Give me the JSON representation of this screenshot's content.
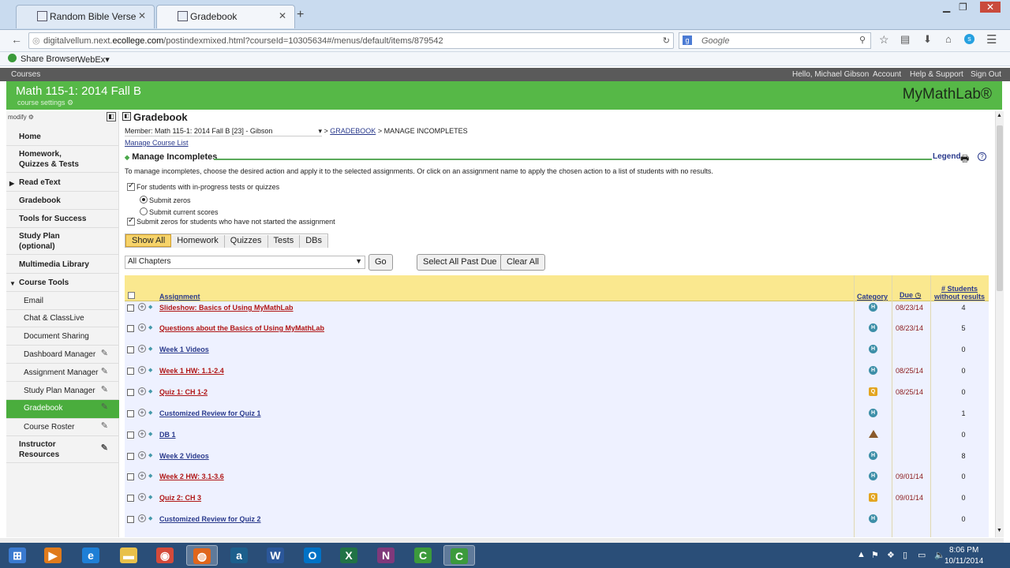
{
  "browser": {
    "tabs": [
      {
        "title": "Random Bible Verse",
        "active": false
      },
      {
        "title": "Gradebook",
        "active": true
      }
    ],
    "url_prefix": "digitalvellum.next.",
    "url_domain": "ecollege.com",
    "url_path": "/postindexmixed.html?courseId=10305634#/menus/default/items/879542",
    "search_placeholder": "Google",
    "bookmarks": [
      "Share Browser",
      "WebEx▾"
    ]
  },
  "topnav": {
    "left": "Courses",
    "greeting": "Hello, Michael Gibson",
    "links": [
      "Account",
      "Help & Support",
      "Sign Out"
    ]
  },
  "course": {
    "title": "Math 115-1: 2014 Fall B",
    "settings": "course settings ⚙",
    "logo": "MyMathLab®"
  },
  "sidebar": {
    "modify": "modify ⚙",
    "items": [
      {
        "label": "Home",
        "type": "top"
      },
      {
        "label": "Homework,\nQuizzes & Tests",
        "type": "top"
      },
      {
        "label": "Read eText",
        "type": "top-arrow"
      },
      {
        "label": "Gradebook",
        "type": "top"
      },
      {
        "label": "Tools for Success",
        "type": "top"
      },
      {
        "label": "Study Plan\n(optional)",
        "type": "top"
      },
      {
        "label": "Multimedia Library",
        "type": "top"
      },
      {
        "label": "Course Tools",
        "type": "top-open"
      },
      {
        "label": "Email",
        "type": "sub"
      },
      {
        "label": "Chat & ClassLive",
        "type": "sub"
      },
      {
        "label": "Document Sharing",
        "type": "sub"
      },
      {
        "label": "Dashboard Manager",
        "type": "sub-edit"
      },
      {
        "label": "Assignment Manager",
        "type": "sub-edit"
      },
      {
        "label": "Study Plan Manager",
        "type": "sub-edit"
      },
      {
        "label": "Gradebook",
        "type": "sub-edit-active"
      },
      {
        "label": "Course Roster",
        "type": "sub-edit"
      },
      {
        "label": "Instructor\nResources",
        "type": "top-edit"
      }
    ]
  },
  "main": {
    "title": "Gradebook",
    "member_select": "Member: Math 115-1: 2014 Fall B [23] - Gibson",
    "crumb_link": "GRADEBOOK",
    "crumb_current": "MANAGE INCOMPLETES",
    "manage_list_link": "Manage Course List",
    "section_title": "Manage Incompletes",
    "legend": "Legend",
    "instructions": "To manage incompletes, choose the desired action and apply it to the selected assignments. Or click on an assignment name to apply the chosen action to a list of students with no results.",
    "opt_inprogress": "For students with in-progress tests or quizzes",
    "opt_submit_zeros": "Submit zeros",
    "opt_submit_current": "Submit current scores",
    "opt_not_started": "Submit zeros for students who have not started the assignment",
    "filters": [
      "Show All",
      "Homework",
      "Quizzes",
      "Tests",
      "DBs"
    ],
    "chapter_select": "All Chapters",
    "go_button": "Go",
    "select_past_due": "Select All Past Due",
    "clear_all": "Clear All",
    "columns": {
      "assignment": "Assignment",
      "category": "Category",
      "due": "Due",
      "students_line1": "# Students",
      "students_line2": "without results"
    },
    "rows": [
      {
        "name": "Slideshow: Basics of Using MyMathLab",
        "color": "red",
        "category": "H",
        "due": "08/23/14",
        "count": "4"
      },
      {
        "name": "Questions about the Basics of Using MyMathLab",
        "color": "red",
        "category": "H",
        "due": "08/23/14",
        "count": "5"
      },
      {
        "name": "Week 1 Videos",
        "color": "blue",
        "category": "H",
        "due": "",
        "count": "0"
      },
      {
        "name": "Week 1 HW: 1.1-2.4",
        "color": "red",
        "category": "H",
        "due": "08/25/14",
        "count": "0"
      },
      {
        "name": "Quiz 1: CH 1-2",
        "color": "red",
        "category": "Q",
        "due": "08/25/14",
        "count": "0"
      },
      {
        "name": "Customized Review for Quiz 1",
        "color": "blue",
        "category": "H",
        "due": "",
        "count": "1"
      },
      {
        "name": "DB 1",
        "color": "blue",
        "category": "D",
        "due": "",
        "count": "0"
      },
      {
        "name": "Week 2 Videos",
        "color": "blue",
        "category": "H",
        "due": "",
        "count": "8"
      },
      {
        "name": "Week 2 HW: 3.1-3.6",
        "color": "red",
        "category": "H",
        "due": "09/01/14",
        "count": "0"
      },
      {
        "name": "Quiz 2: CH 3",
        "color": "red",
        "category": "Q",
        "due": "09/01/14",
        "count": "0"
      },
      {
        "name": "Customized Review for Quiz 2",
        "color": "blue",
        "category": "H",
        "due": "",
        "count": "0"
      }
    ]
  },
  "taskbar": {
    "apps": [
      "start-orb",
      "media-player",
      "internet-explorer",
      "file-explorer",
      "chrome",
      "firefox",
      "a",
      "W",
      "O",
      "X",
      "N",
      "C",
      "C"
    ],
    "time": "8:06 PM",
    "date": "10/11/2014"
  },
  "colors": {
    "green": "#56b847",
    "header_yellow": "#fae88f",
    "row_bg": "#eef1ff",
    "link": "#2a3a8c",
    "due_red": "#8a1a1a"
  }
}
